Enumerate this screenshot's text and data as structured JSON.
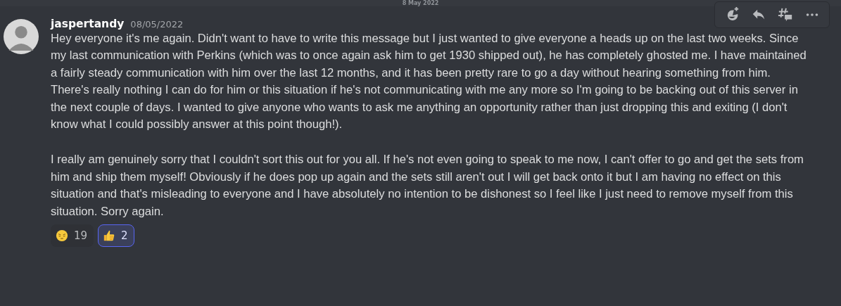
{
  "date_divider": "8 May 2022",
  "message": {
    "author": "jaspertandy",
    "timestamp": "08/05/2022",
    "paragraphs": [
      "Hey everyone it's me again. Didn't want to have to write this message but I just wanted to give everyone a heads up on the last two weeks. Since my last communication with Perkins (which was to once again ask him to get 1930 shipped out), he has completely ghosted me. I have maintained a fairly steady communication with him over the last 12 months, and it has been pretty rare to go a day without hearing something from him. There's really nothing I can do for him or this situation if he's not communicating with me any more so I'm going to be backing out of this server in the next couple of days. I wanted to give anyone who wants to ask me anything an opportunity rather than just dropping this and exiting (I don't know what I could possibly answer at this point though!).",
      "I really am genuinely sorry that I couldn't sort this out for you all. If he's not even going to speak to me now, I can't offer to go and get the sets from him and ship them myself! Obviously if he does pop up again and the sets still aren't out I will get back onto it but I am having no effect on this situation and that's misleading to everyone and I have absolutely no intention to be dishonest so I feel like I just need to remove myself from this situation. Sorry again."
    ],
    "reactions": [
      {
        "kind": "pensive",
        "count": "19",
        "selected": false
      },
      {
        "kind": "thumbsup",
        "count": "2",
        "selected": true
      }
    ]
  },
  "toolbar": [
    {
      "kind": "add-reaction"
    },
    {
      "kind": "reply"
    },
    {
      "kind": "thread"
    },
    {
      "kind": "more"
    }
  ]
}
